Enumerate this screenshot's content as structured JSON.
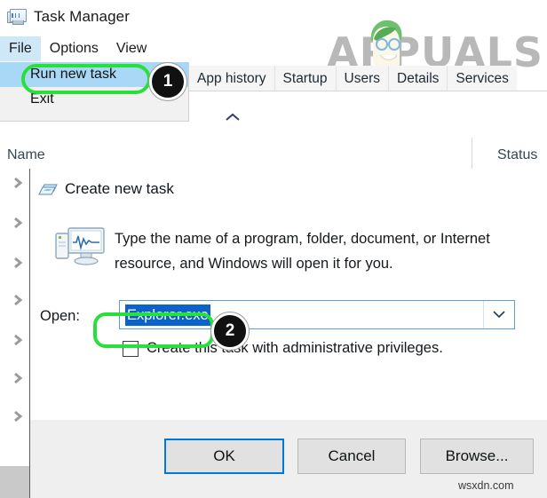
{
  "window": {
    "title": "Task Manager",
    "title_icon": "task-manager-icon"
  },
  "menubar": {
    "items": [
      {
        "label": "File",
        "active": true
      },
      {
        "label": "Options",
        "active": false
      },
      {
        "label": "View",
        "active": false
      }
    ]
  },
  "file_menu": {
    "items": [
      {
        "label": "Run new task",
        "highlighted": true
      },
      {
        "label": "Exit",
        "highlighted": false
      }
    ]
  },
  "tabs": [
    {
      "label": "App history"
    },
    {
      "label": "Startup"
    },
    {
      "label": "Users"
    },
    {
      "label": "Details"
    },
    {
      "label": "Services"
    }
  ],
  "columns": {
    "name": "Name",
    "status": "Status"
  },
  "dialog": {
    "title": "Create new task",
    "title_icon": "new-task-icon",
    "close_icon": "close-icon",
    "pc_icon": "computer-monitor-icon",
    "description": "Type the name of a program, folder, document, or Internet resource, and Windows will open it for you.",
    "open_label": "Open:",
    "open_value": "Explorer.exe",
    "open_value_selected": true,
    "dropdown_icon": "chevron-down-icon",
    "checkbox": {
      "label": "Create this task with administrative privileges.",
      "checked": false
    },
    "buttons": {
      "ok": "OK",
      "cancel": "Cancel",
      "browse": "Browse..."
    }
  },
  "annotations": [
    {
      "number": "1",
      "target": "Run new task"
    },
    {
      "number": "2",
      "target": "Explorer.exe"
    }
  ],
  "watermarks": {
    "brand": "APPUALS",
    "site": "wsxdn.com"
  },
  "colors": {
    "accent": "#0078d7",
    "selection": "#0a63c9",
    "menu_highlight": "#a8d8f5",
    "callout_ring": "#28e03a",
    "badge_bg": "#111111"
  }
}
